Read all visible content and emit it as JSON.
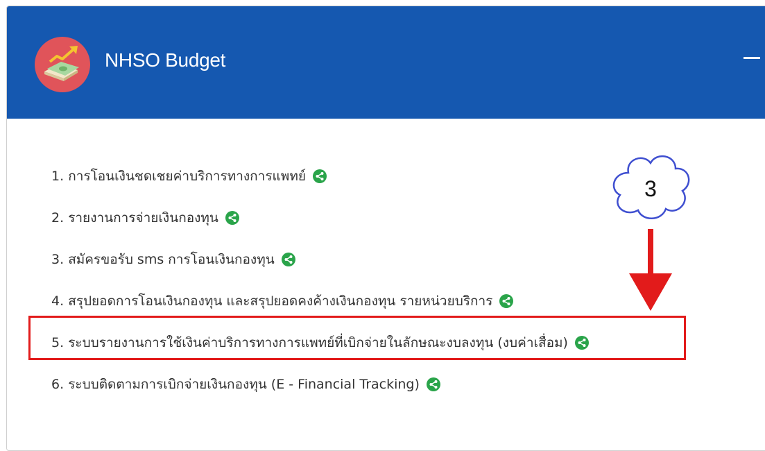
{
  "panel": {
    "title": "NHSO Budget",
    "logo_icon": "money-chart-icon",
    "collapse_icon": "minus-icon"
  },
  "links": [
    {
      "number": "1.",
      "label": "การโอนเงินชดเชยค่าบริการทางการแพทย์"
    },
    {
      "number": "2.",
      "label": "รายงานการจ่ายเงินกองทุน"
    },
    {
      "number": "3.",
      "label": "สมัครขอรับ sms การโอนเงินกองทุน"
    },
    {
      "number": "4.",
      "label": "สรุปยอดการโอนเงินกองทุน และสรุปยอดคงค้างเงินกองทุน รายหน่วยบริการ"
    },
    {
      "number": "5.",
      "label": "ระบบรายงานการใช้เงินค่าบริการทางการแพทย์ที่เบิกจ่ายในลักษณะงบลงทุน (งบค่าเสื่อม)"
    },
    {
      "number": "6.",
      "label": "ระบบติดตามการเบิกจ่ายเงินกองทุน (E - Financial Tracking)"
    }
  ],
  "annotation": {
    "step_number": "3",
    "highlight_color": "#e21b1b",
    "arrow_color": "#e21b1b"
  },
  "colors": {
    "header_bg": "#1558b0",
    "share_icon": "#2aa44a",
    "logo_bg": "#e0545a"
  }
}
